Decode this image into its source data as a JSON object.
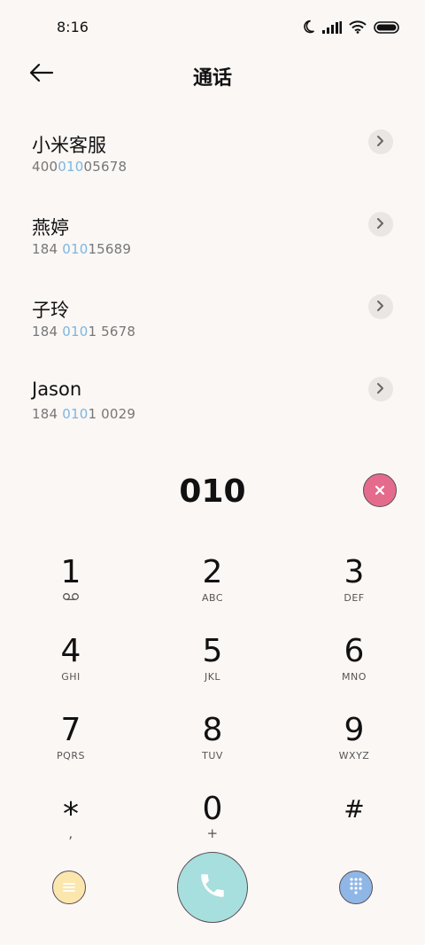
{
  "status_bar": {
    "time": "8:16",
    "icons": [
      "moon-icon",
      "signal-icon",
      "wifi-icon",
      "battery-icon"
    ]
  },
  "header": {
    "title": "通话",
    "back_icon": "arrow-left-icon"
  },
  "contacts": [
    {
      "name": "小米客服",
      "number_pre": "400",
      "number_match": "010",
      "number_post": "05678"
    },
    {
      "name": "燕婷",
      "number_pre": "184 ",
      "number_match": "010",
      "number_post": "15689"
    },
    {
      "name": "子玲",
      "number_pre": "184 ",
      "number_match": "010",
      "number_post": "1 5678"
    },
    {
      "name": "Jason",
      "number_pre": "184 ",
      "number_match": "010",
      "number_post": "1 0029"
    }
  ],
  "dialer": {
    "input": "010"
  },
  "keypad": [
    [
      {
        "digit": "1",
        "letters": ""
      },
      {
        "digit": "2",
        "letters": "ABC"
      },
      {
        "digit": "3",
        "letters": "DEF"
      }
    ],
    [
      {
        "digit": "4",
        "letters": "GHI"
      },
      {
        "digit": "5",
        "letters": "JKL"
      },
      {
        "digit": "6",
        "letters": "MNO"
      }
    ],
    [
      {
        "digit": "7",
        "letters": "PQRS"
      },
      {
        "digit": "8",
        "letters": "TUV"
      },
      {
        "digit": "9",
        "letters": "WXYZ"
      }
    ],
    [
      {
        "digit": "*",
        "letters": ","
      },
      {
        "digit": "0",
        "letters": "+"
      },
      {
        "digit": "#",
        "letters": ""
      }
    ]
  ],
  "colors": {
    "background": "#fbf7f5",
    "highlight": "#7cb6e0",
    "delete": "#e56b8d",
    "menu": "#fbe6ae",
    "call": "#a6dfdd",
    "keypad_toggle": "#8fb7e6"
  }
}
